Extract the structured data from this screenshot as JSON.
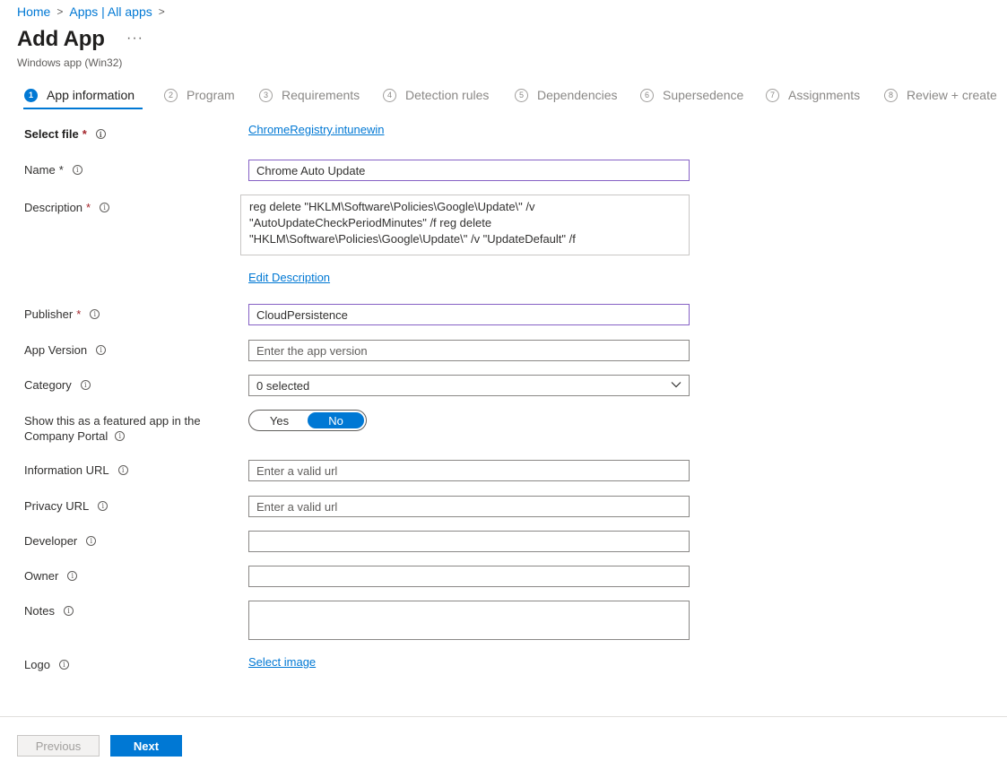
{
  "breadcrumb": {
    "home": "Home",
    "apps": "Apps | All apps"
  },
  "header": {
    "title": "Add App",
    "more": "···",
    "subtitle": "Windows app (Win32)"
  },
  "steps": [
    {
      "num": "1",
      "label": "App information",
      "active": true
    },
    {
      "num": "2",
      "label": "Program"
    },
    {
      "num": "3",
      "label": "Requirements"
    },
    {
      "num": "4",
      "label": "Detection rules"
    },
    {
      "num": "5",
      "label": "Dependencies"
    },
    {
      "num": "6",
      "label": "Supersedence"
    },
    {
      "num": "7",
      "label": "Assignments"
    },
    {
      "num": "8",
      "label": "Review + create"
    }
  ],
  "form": {
    "select_file": {
      "label": "Select file",
      "value": "ChromeRegistry.intunewin"
    },
    "name": {
      "label": "Name",
      "value": "Chrome Auto Update"
    },
    "description": {
      "label": "Description",
      "value": "reg delete \"HKLM\\Software\\Policies\\Google\\Update\\\" /v \"AutoUpdateCheckPeriodMinutes\" /f reg delete \"HKLM\\Software\\Policies\\Google\\Update\\\" /v \"UpdateDefault\" /f",
      "edit_link": "Edit Description"
    },
    "publisher": {
      "label": "Publisher",
      "value": "CloudPersistence"
    },
    "app_version": {
      "label": "App Version",
      "placeholder": "Enter the app version"
    },
    "category": {
      "label": "Category",
      "value": "0 selected"
    },
    "featured": {
      "label_line1": "Show this as a featured app in the",
      "label_line2": "Company Portal",
      "yes": "Yes",
      "no": "No",
      "selected": "No"
    },
    "information_url": {
      "label": "Information URL",
      "placeholder": "Enter a valid url"
    },
    "privacy_url": {
      "label": "Privacy URL",
      "placeholder": "Enter a valid url"
    },
    "developer": {
      "label": "Developer",
      "value": ""
    },
    "owner": {
      "label": "Owner",
      "value": ""
    },
    "notes": {
      "label": "Notes",
      "value": ""
    },
    "logo": {
      "label": "Logo",
      "link": "Select image"
    }
  },
  "required_mark": "*",
  "info_glyph": "i",
  "footer": {
    "previous": "Previous",
    "next": "Next"
  },
  "colors": {
    "accent": "#0078d4",
    "required": "#a4262c",
    "focus_border": "#8661c5"
  }
}
